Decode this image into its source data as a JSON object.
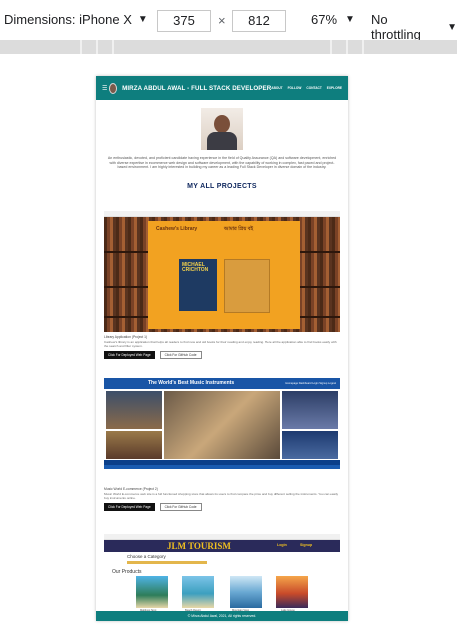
{
  "toolbar": {
    "dimensions_label": "Dimensions: iPhone X",
    "width_value": "375",
    "times": "×",
    "height_value": "812",
    "zoom": "67%",
    "throttling": "No throttling"
  },
  "site": {
    "nav": {
      "menu_icon": "hamburger-menu-icon",
      "brand": "MIRZA ABDUL AWAL - FULL STACK DEVELOPER",
      "links": [
        "ABOUT",
        "FOLLOW",
        "CONTACT",
        "EXPLORE"
      ]
    },
    "intro": "An enthusiastic, devoted, and proficient candidate having experience in the field of Quality Assurance (QA) and software development, enriched with diverse expertise in ecommerce web design and software development, with the capability of working in complex, fast paced and project-based environment. I am highly interested in building my career as a leading Full Stack Developer in diverse domain of the industry.",
    "projects_title": "MY ALL PROJECTS",
    "projects": [
      {
        "shot_heading": "Cashew's Library",
        "shot_heading_2": "আমার প্রিয় বই",
        "book_title": "MICHAEL CRICHTON",
        "title": "Library Application (Project 1)",
        "description": "Cashew's library is an application that helps all readers to find new and old books for their reading and enjoy reading. Here all the application able to find books easily with the search and filter system.",
        "btn_live": "Click For Deployed Web Page",
        "btn_code": "Click For GitHub Code"
      },
      {
        "shot_heading": "The World's Best Music Instruments",
        "shot_links": "Homepage  Dashboard  Login  Signup  Logout",
        "title": "Music World E-commerce (Project 2)",
        "description": "Music World E-commerce web site is a full functioned shopping store that allows its users to find compare the price and buy different selling the instruments. You can easily buy instruments online.",
        "btn_live": "Click For Deployed Web Page",
        "btn_code": "Click For GitHub Code"
      },
      {
        "shot_heading": "JLM TOURISM",
        "login": "Login",
        "signup": "Signup",
        "category": "Choose a Category",
        "products": "Our Products",
        "captions": [
          "Maldives Spot",
          "Beach Resort",
          "Mountain View",
          "Lake House"
        ]
      }
    ],
    "footer": "© Mirza Abdul Awal, 2021, All rights reserved."
  },
  "colors": {
    "nav_bg": "#0e7e7e",
    "title_color": "#122a60",
    "music_blue": "#1955a6"
  }
}
